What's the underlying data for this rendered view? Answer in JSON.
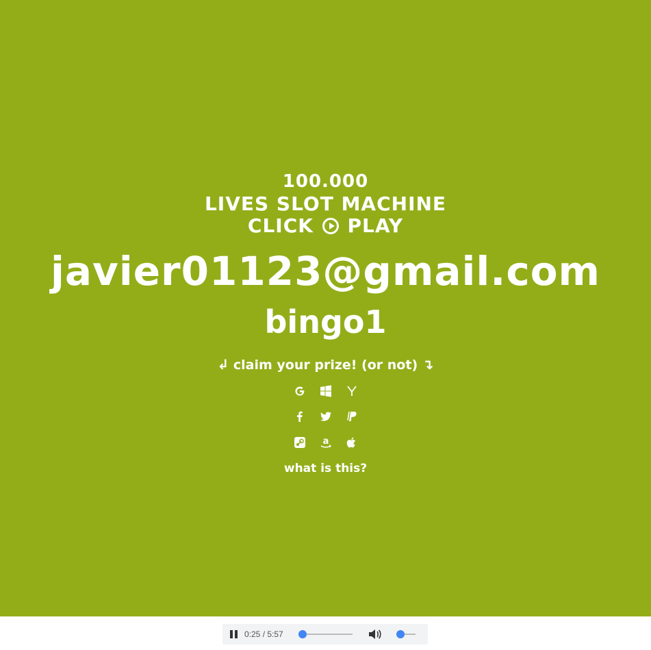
{
  "banner": {
    "line1": "100.000",
    "line2": "LIVES SLOT MACHINE",
    "line3_before": "CLICK",
    "line3_after": "PLAY"
  },
  "credentials": {
    "email": "javier01123@gmail.com",
    "password": "bingo1"
  },
  "claim": {
    "left_arrow": "↲",
    "text": "claim your prize! (or not)",
    "right_arrow": "↴"
  },
  "icons": {
    "row1": [
      "google-icon",
      "windows-icon",
      "yahoo-icon"
    ],
    "row2": [
      "facebook-icon",
      "twitter-icon",
      "paypal-icon"
    ],
    "row3": [
      "steam-icon",
      "amazon-icon",
      "apple-icon"
    ]
  },
  "what_link": "what is this?",
  "player": {
    "time": "0:25 / 5:57",
    "progress": 0.07,
    "volume": 0.0
  },
  "colors": {
    "background": "#93ad19",
    "text": "#ffffff",
    "accent": "#4285f4"
  }
}
